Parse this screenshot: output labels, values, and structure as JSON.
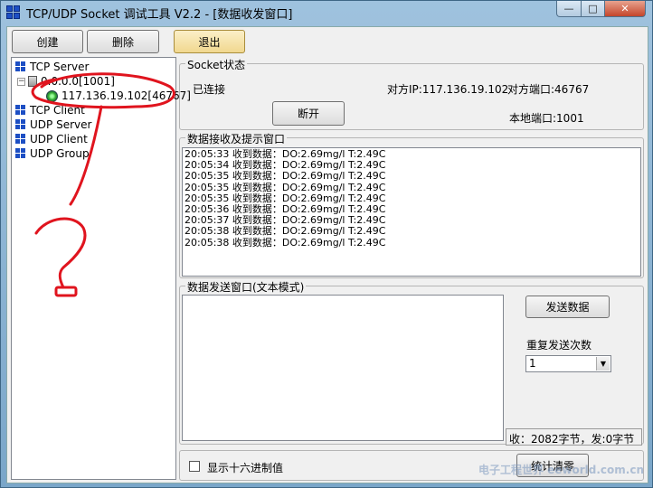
{
  "window": {
    "title": "TCP/UDP Socket 调试工具 V2.2 - [数据收发窗口]",
    "controls": {
      "minimize": "—",
      "maximize": "□",
      "close": "✕"
    }
  },
  "toolbar": {
    "create": "创建",
    "delete": "删除",
    "exit": "退出"
  },
  "tree": {
    "tcp_server": "TCP Server",
    "server_node": "0.0.0.0[1001]",
    "connection": "117.136.19.102[46767]",
    "tcp_client": "TCP Client",
    "udp_server": "UDP Server",
    "udp_client": "UDP Client",
    "udp_group": "UDP Group"
  },
  "socket_status": {
    "label": "Socket状态",
    "state": "已连接",
    "peer_ip": "对方IP:117.136.19.102",
    "peer_port": "对方端口:46767",
    "local_port": "本地端口:1001",
    "disconnect": "断开"
  },
  "receive": {
    "label": "数据接收及提示窗口",
    "lines": [
      "20:05:33 收到数据：DO:2.69mg/l T:2.49C",
      "20:05:34 收到数据：DO:2.69mg/l T:2.49C",
      "20:05:35 收到数据：DO:2.69mg/l T:2.49C",
      "20:05:35 收到数据：DO:2.69mg/l T:2.49C",
      "20:05:35 收到数据：DO:2.69mg/l T:2.49C",
      "20:05:36 收到数据：DO:2.69mg/l T:2.49C",
      "20:05:37 收到数据：DO:2.69mg/l T:2.49C",
      "20:05:38 收到数据：DO:2.69mg/l T:2.49C",
      "20:05:38 收到数据：DO:2.69mg/l T:2.49C"
    ]
  },
  "send": {
    "label": "数据发送窗口(文本模式)",
    "text": "",
    "send_button": "发送数据",
    "repeat_label": "重复发送次数",
    "repeat_value": "1",
    "stats": "收：2082字节，发:0字节"
  },
  "bottom": {
    "hex_label": "显示十六进制值",
    "reset_stats": "统计清零"
  },
  "watermark": "电子工程世界 eeworld.com.cn",
  "annotation": {
    "mark": "?",
    "color": "#e0141e"
  }
}
